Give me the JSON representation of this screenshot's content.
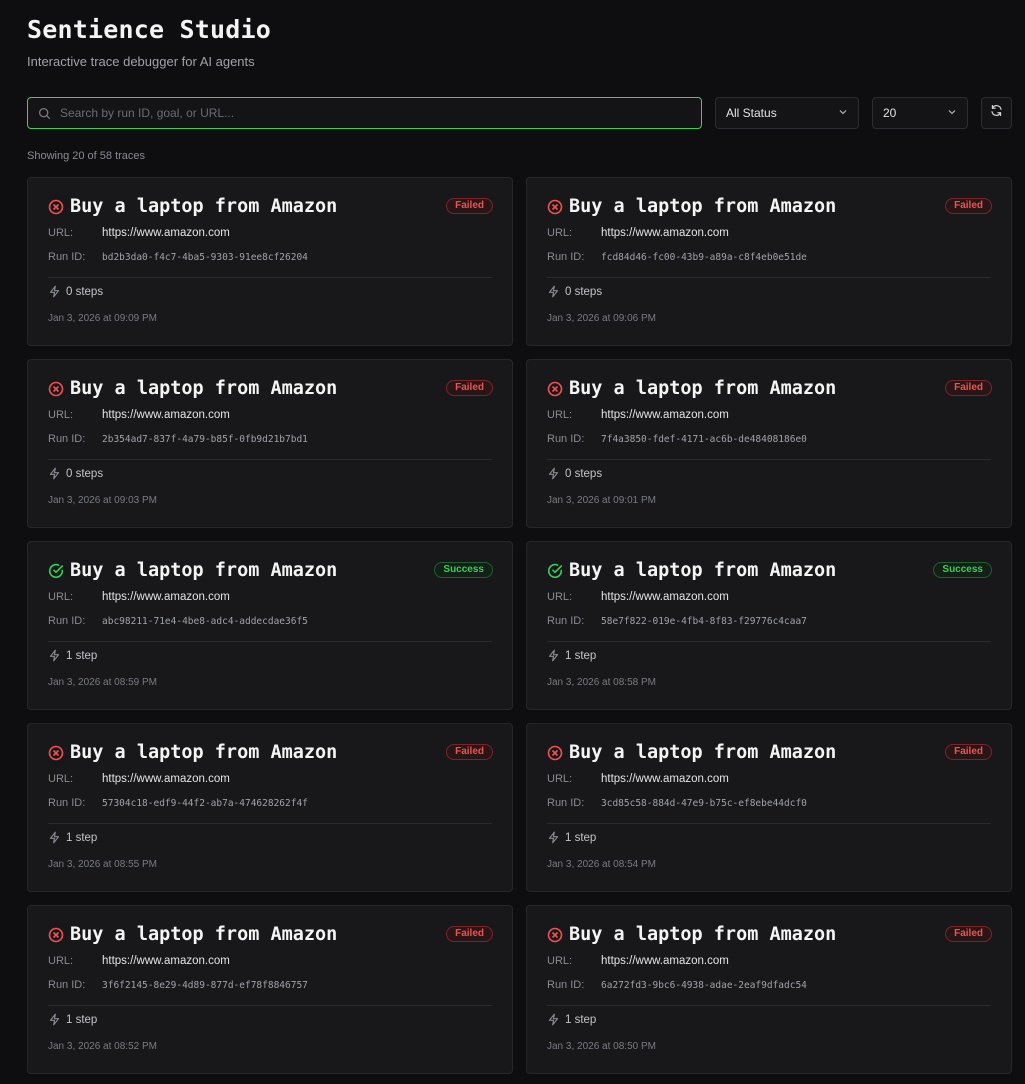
{
  "app": {
    "title": "Sentience Studio",
    "subtitle": "Interactive trace debugger for AI agents"
  },
  "toolbar": {
    "search_placeholder": "Search by run ID, goal, or URL...",
    "status_filter": "All Status",
    "page_size": "20",
    "search_icon": "search-icon",
    "refresh_icon": "refresh-icon"
  },
  "summary": "Showing 20 of 58 traces",
  "labels": {
    "url": "URL:",
    "run_id": "Run ID:"
  },
  "colors": {
    "accent_green": "#3ecf5a",
    "failed_red": "#f05252",
    "success_green": "#34d058",
    "background": "#0e0e10",
    "card": "#18181b"
  },
  "traces": [
    {
      "goal": "Buy a laptop from Amazon",
      "status": "Failed",
      "url": "https://www.amazon.com",
      "run_id": "bd2b3da0-f4c7-4ba5-9303-91ee8cf26204",
      "steps": "0 steps",
      "date": "Jan 3, 2026 at 09:09 PM"
    },
    {
      "goal": "Buy a laptop from Amazon",
      "status": "Failed",
      "url": "https://www.amazon.com",
      "run_id": "fcd84d46-fc00-43b9-a89a-c8f4eb0e51de",
      "steps": "0 steps",
      "date": "Jan 3, 2026 at 09:06 PM"
    },
    {
      "goal": "Buy a laptop from Amazon",
      "status": "Failed",
      "url": "https://www.amazon.com",
      "run_id": "2b354ad7-837f-4a79-b85f-0fb9d21b7bd1",
      "steps": "0 steps",
      "date": "Jan 3, 2026 at 09:03 PM"
    },
    {
      "goal": "Buy a laptop from Amazon",
      "status": "Failed",
      "url": "https://www.amazon.com",
      "run_id": "7f4a3850-fdef-4171-ac6b-de48408186e0",
      "steps": "0 steps",
      "date": "Jan 3, 2026 at 09:01 PM"
    },
    {
      "goal": "Buy a laptop from Amazon",
      "status": "Success",
      "url": "https://www.amazon.com",
      "run_id": "abc98211-71e4-4be8-adc4-addecdae36f5",
      "steps": "1 step",
      "date": "Jan 3, 2026 at 08:59 PM"
    },
    {
      "goal": "Buy a laptop from Amazon",
      "status": "Success",
      "url": "https://www.amazon.com",
      "run_id": "58e7f822-019e-4fb4-8f83-f29776c4caa7",
      "steps": "1 step",
      "date": "Jan 3, 2026 at 08:58 PM"
    },
    {
      "goal": "Buy a laptop from Amazon",
      "status": "Failed",
      "url": "https://www.amazon.com",
      "run_id": "57304c18-edf9-44f2-ab7a-474628262f4f",
      "steps": "1 step",
      "date": "Jan 3, 2026 at 08:55 PM"
    },
    {
      "goal": "Buy a laptop from Amazon",
      "status": "Failed",
      "url": "https://www.amazon.com",
      "run_id": "3cd85c58-884d-47e9-b75c-ef8ebe44dcf0",
      "steps": "1 step",
      "date": "Jan 3, 2026 at 08:54 PM"
    },
    {
      "goal": "Buy a laptop from Amazon",
      "status": "Failed",
      "url": "https://www.amazon.com",
      "run_id": "3f6f2145-8e29-4d89-877d-ef78f8846757",
      "steps": "1 step",
      "date": "Jan 3, 2026 at 08:52 PM"
    },
    {
      "goal": "Buy a laptop from Amazon",
      "status": "Failed",
      "url": "https://www.amazon.com",
      "run_id": "6a272fd3-9bc6-4938-adae-2eaf9dfadc54",
      "steps": "1 step",
      "date": "Jan 3, 2026 at 08:50 PM"
    }
  ]
}
